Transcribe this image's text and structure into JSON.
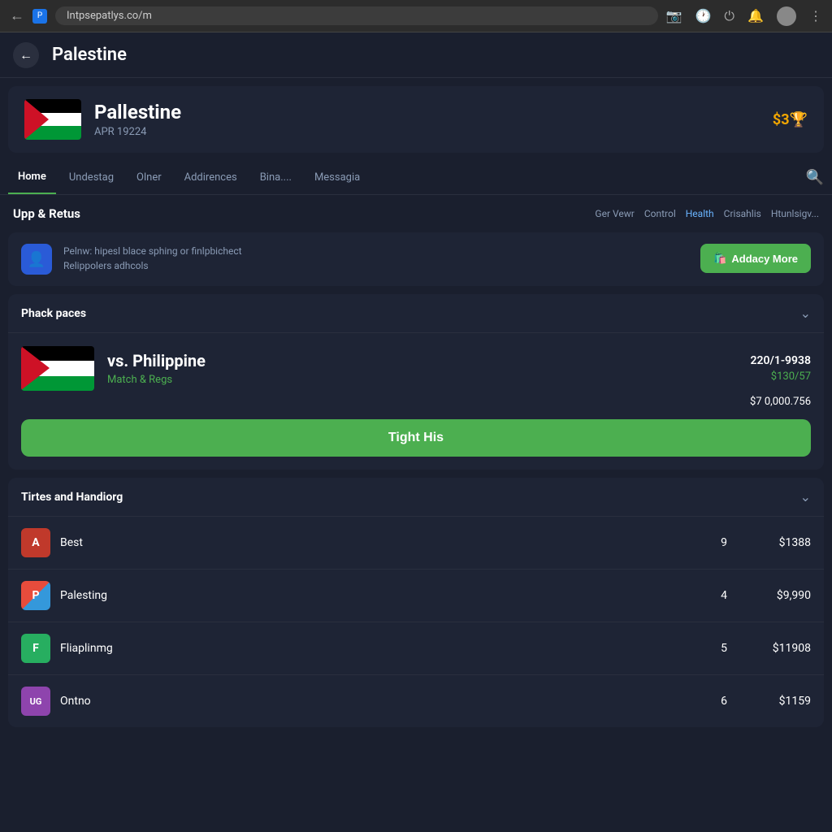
{
  "browser": {
    "url": "Intpsepatlys.co/m",
    "back_icon": "←",
    "favicon": "P",
    "icons": [
      "📷",
      "🕐",
      "⏻",
      "🔔",
      "⋮"
    ]
  },
  "app_header": {
    "back_icon": "←",
    "title": "Palestine"
  },
  "team_banner": {
    "name": "Pallestine",
    "date": "APR 19224",
    "price": "$3🏆"
  },
  "nav_tabs": {
    "tabs": [
      {
        "label": "Home",
        "active": true
      },
      {
        "label": "Undestag",
        "active": false
      },
      {
        "label": "Olner",
        "active": false
      },
      {
        "label": "Addirences",
        "active": false
      },
      {
        "label": "Bina....",
        "active": false
      },
      {
        "label": "Messagia",
        "active": false
      }
    ],
    "search_icon": "🔍"
  },
  "upp_section": {
    "title": "Upp & Retus",
    "filters": [
      {
        "label": "Ger Vewr",
        "class": ""
      },
      {
        "label": "Control",
        "class": ""
      },
      {
        "label": "Health",
        "class": "health"
      },
      {
        "label": "Crisahlis",
        "class": ""
      },
      {
        "label": "Htunlsigv...",
        "class": ""
      }
    ],
    "info_text_line1": "Pelnw: hipesl blace sphing or finlpbichect",
    "info_text_line2": "Relippolers adhcols",
    "add_more_label": "Addacy More"
  },
  "match_section": {
    "title": "Phack paces",
    "vs_text": "vs. Philippine",
    "match_reps": "Match & Regs",
    "score": "220/1-9938",
    "amount": "$130/57",
    "total": "$7 0,000.756",
    "action_label": "Tight His"
  },
  "rankings_section": {
    "title": "Tirtes and Handiorg",
    "rows": [
      {
        "name": "Best",
        "logo_bg": "#c0392b",
        "logo_text": "A",
        "rank": 9,
        "value": "$1388"
      },
      {
        "name": "Palesting",
        "logo_bg": "#e67e22",
        "logo_text": "P",
        "rank": 4,
        "value": "$9,990"
      },
      {
        "name": "Fliaplinmg",
        "logo_bg": "#27ae60",
        "logo_text": "F",
        "rank": 5,
        "value": "$11908"
      },
      {
        "name": "Ontno",
        "logo_bg": "#8e44ad",
        "logo_text": "UG",
        "rank": 6,
        "value": "$1159"
      }
    ]
  }
}
